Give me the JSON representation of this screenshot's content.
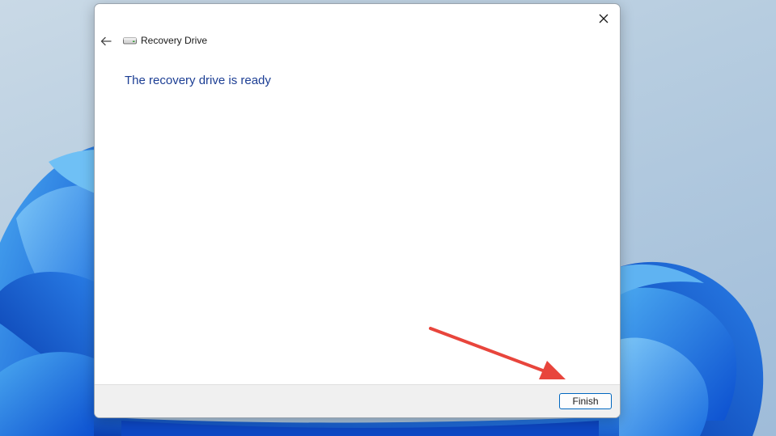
{
  "window": {
    "title": "Recovery Drive",
    "heading": "The recovery drive is ready"
  },
  "footer": {
    "finish_label": "Finish"
  },
  "icons": {
    "back": "back-arrow-icon",
    "close": "close-icon",
    "drive": "drive-icon"
  },
  "colors": {
    "heading": "#1c3e94",
    "accent_border": "#0067c0",
    "annotation_arrow": "#e8453c"
  }
}
